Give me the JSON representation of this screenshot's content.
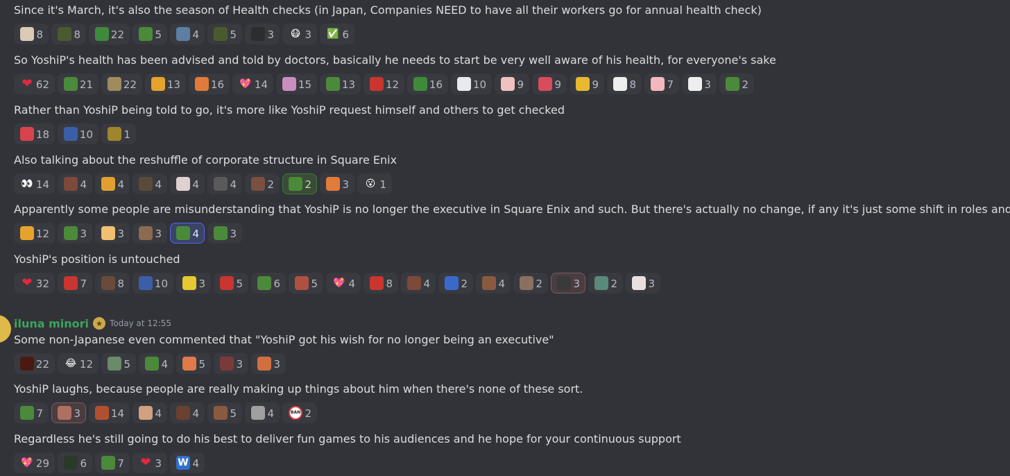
{
  "author": {
    "name": "iluna minori",
    "timestamp": "Today at 12:55",
    "badge_icon": "star-badge-icon",
    "name_color": "#3ba55c"
  },
  "messages": [
    "Since it's March, it's also the season of Health checks (in Japan, Companies NEED to have all their workers go for annual health check)",
    "So YoshiP's health has been advised and told by doctors, basically he needs to start be very well aware of his health, for everyone's sake",
    "Rather than YoshiP being told to go, it's more like YoshiP request himself and others to get checked",
    "Also talking about the reshuffle of corporate structure in Square Enix",
    "Apparently some people are misunderstanding that YoshiP is no longer the executive in Square Enix and such. But there's actually no change, if any it's just some shift in roles and so on",
    "YoshiP's position is untouched",
    "Some non-Japanese even commented that \"YoshiP got his wish for no longer being an executive\"",
    "YoshiP laughs, because people are really making up things about him  when there's none of these sort.",
    "Regardless he's still going to do his best to deliver fun games to his audiences and he hope for your continuous support"
  ],
  "reaction_rows": [
    [
      {
        "icon": "cat-emoji-icon",
        "count": "8",
        "bg": "#d9cbb5"
      },
      {
        "icon": "bamboo-emoji-icon",
        "count": "8",
        "bg": "#4b5a2e"
      },
      {
        "icon": "medic-cross-icon",
        "count": "22",
        "bg": "#3f8a3a"
      },
      {
        "icon": "frog-car-icon",
        "count": "5",
        "bg": "#4b8a3a"
      },
      {
        "icon": "robot-emoji-icon",
        "count": "4",
        "bg": "#5c7fa3"
      },
      {
        "icon": "bamboo-emoji-icon",
        "count": "5",
        "bg": "#4b5a2e"
      },
      {
        "icon": "blank-emoji-icon",
        "count": "3",
        "bg": "#2b2d31"
      },
      {
        "icon": "mask-face-icon",
        "count": "3",
        "glyph": "😷"
      },
      {
        "icon": "check-mark-icon",
        "count": "6",
        "glyph": "✅"
      }
    ],
    [
      {
        "icon": "heart-icon",
        "count": "62",
        "glyph": "❤"
      },
      {
        "icon": "frog-heart-icon",
        "count": "21",
        "bg": "#4b8a3a"
      },
      {
        "icon": "cat-emoji-icon",
        "count": "22",
        "bg": "#a08a60"
      },
      {
        "icon": "hug-heart-icon",
        "count": "13",
        "bg": "#e6a32c"
      },
      {
        "icon": "cat-hug-icon",
        "count": "16",
        "bg": "#e07b3a"
      },
      {
        "icon": "sparkle-heart-icon",
        "count": "14",
        "glyph": "💖"
      },
      {
        "icon": "anime-girl-icon",
        "count": "15",
        "bg": "#c98ec0"
      },
      {
        "icon": "frog-car-icon",
        "count": "13",
        "bg": "#4b8a3a"
      },
      {
        "icon": "crab-emoji-icon",
        "count": "12",
        "bg": "#c9352f"
      },
      {
        "icon": "medic-cross-icon",
        "count": "16",
        "bg": "#3f8a3a"
      },
      {
        "icon": "ghost-emoji-icon",
        "count": "10",
        "bg": "#e8e8ef"
      },
      {
        "icon": "chick-emoji-icon",
        "count": "9",
        "bg": "#f1c0c0"
      },
      {
        "icon": "heart-ring-icon",
        "count": "9",
        "bg": "#d94c5c"
      },
      {
        "icon": "duck-emoji-icon",
        "count": "9",
        "bg": "#e8b830"
      },
      {
        "icon": "chicken-emoji-icon",
        "count": "8",
        "bg": "#eeeeee"
      },
      {
        "icon": "pig-emoji-icon",
        "count": "7",
        "bg": "#f2b8c0"
      },
      {
        "icon": "bunny-emoji-icon",
        "count": "3",
        "bg": "#eeeeee"
      },
      {
        "icon": "frog-emoji-icon",
        "count": "2",
        "bg": "#4b8a3a"
      }
    ],
    [
      {
        "icon": "rocket-heart-icon",
        "count": "18",
        "bg": "#d9434b"
      },
      {
        "icon": "this-arrow-icon",
        "count": "10",
        "bg": "#3a5fa8"
      },
      {
        "icon": "bird-emoji-icon",
        "count": "1",
        "bg": "#a0852e"
      }
    ],
    [
      {
        "icon": "eyes-icon",
        "count": "14",
        "glyph": "👀"
      },
      {
        "icon": "anime-girl-icon",
        "count": "4",
        "bg": "#7d4a3a"
      },
      {
        "icon": "dancer-emoji-icon",
        "count": "4",
        "bg": "#e0a030"
      },
      {
        "icon": "knife-emoji-icon",
        "count": "4",
        "bg": "#5a4a3a"
      },
      {
        "icon": "anime-girl-icon",
        "count": "4",
        "bg": "#e0d0d0"
      },
      {
        "icon": "stonks-icon",
        "count": "4",
        "bg": "#5a5a5a"
      },
      {
        "icon": "man-face-icon",
        "count": "2",
        "bg": "#7a5040"
      },
      {
        "icon": "frog-emoji-icon",
        "count": "2",
        "bg": "#4b8a3a",
        "active": "green"
      },
      {
        "icon": "fire-emoji-icon",
        "count": "3",
        "bg": "#e07b3a"
      },
      {
        "icon": "surprised-face-icon",
        "count": "1",
        "glyph": "😮"
      }
    ],
    [
      {
        "icon": "hug-heart-icon",
        "count": "12",
        "bg": "#e6a32c"
      },
      {
        "icon": "frog-emoji-icon",
        "count": "3",
        "bg": "#4b8a3a"
      },
      {
        "icon": "chicken-emoji-icon",
        "count": "3",
        "bg": "#f0c070"
      },
      {
        "icon": "people-emoji-icon",
        "count": "3",
        "bg": "#8a6a50"
      },
      {
        "icon": "frog-car-icon",
        "count": "4",
        "bg": "#4b8a3a",
        "active": "blue"
      },
      {
        "icon": "frog-emoji-icon",
        "count": "3",
        "bg": "#4b8a3a"
      }
    ],
    [
      {
        "icon": "heart-icon",
        "count": "32",
        "glyph": "❤"
      },
      {
        "icon": "knife-emoji-icon",
        "count": "7",
        "bg": "#c9352f"
      },
      {
        "icon": "bird-emoji-icon",
        "count": "8",
        "bg": "#6a4a3a"
      },
      {
        "icon": "this-arrow-icon",
        "count": "10",
        "bg": "#3a5fa8"
      },
      {
        "icon": "minion-emoji-icon",
        "count": "3",
        "bg": "#e8c830"
      },
      {
        "icon": "devil-emoji-icon",
        "count": "5",
        "bg": "#c9352f"
      },
      {
        "icon": "frog-emoji-icon",
        "count": "6",
        "bg": "#4b8a3a"
      },
      {
        "icon": "man-face-icon",
        "count": "5",
        "bg": "#b05040"
      },
      {
        "icon": "sparkle-heart-icon",
        "count": "4",
        "glyph": "💖"
      },
      {
        "icon": "this-arrow-icon",
        "count": "8",
        "bg": "#c9352f"
      },
      {
        "icon": "anime-girl-icon",
        "count": "4",
        "bg": "#7d4a3a"
      },
      {
        "icon": "blue-character-icon",
        "count": "2",
        "bg": "#3a6ac9"
      },
      {
        "icon": "woman-emoji-icon",
        "count": "4",
        "bg": "#8a5a40"
      },
      {
        "icon": "man-face-icon",
        "count": "2",
        "bg": "#8a7060"
      },
      {
        "icon": "dark-character-icon",
        "count": "3",
        "bg": "#3a3a3a",
        "active": "red"
      },
      {
        "icon": "anime-girl-icon",
        "count": "2",
        "bg": "#5a8a7a"
      },
      {
        "icon": "anime-girl-icon",
        "count": "3",
        "bg": "#e8e0e0"
      }
    ],
    [
      {
        "icon": "circle-emoji-icon",
        "count": "22",
        "bg": "#4a1a12"
      },
      {
        "icon": "laughing-face-icon",
        "count": "12",
        "glyph": "😂"
      },
      {
        "icon": "monster-emoji-icon",
        "count": "5",
        "bg": "#6a8a6a"
      },
      {
        "icon": "frog-emoji-icon",
        "count": "4",
        "bg": "#4b8a3a"
      },
      {
        "icon": "man-face-icon",
        "count": "5",
        "bg": "#e07a4a"
      },
      {
        "icon": "lips-emoji-icon",
        "count": "3",
        "bg": "#7a3a3a"
      },
      {
        "icon": "man-face-icon",
        "count": "3",
        "bg": "#d07040"
      }
    ],
    [
      {
        "icon": "frog-car-icon",
        "count": "7",
        "bg": "#4b8a3a"
      },
      {
        "icon": "woman-emoji-icon",
        "count": "3",
        "bg": "#b07060",
        "active": "red"
      },
      {
        "icon": "eyes-closeup-icon",
        "count": "14",
        "bg": "#b05030"
      },
      {
        "icon": "man-face-icon",
        "count": "4",
        "bg": "#d0a080"
      },
      {
        "icon": "man-face-icon",
        "count": "4",
        "bg": "#6a4030"
      },
      {
        "icon": "woman-emoji-icon",
        "count": "5",
        "bg": "#8a5a40"
      },
      {
        "icon": "man-face-icon",
        "count": "4",
        "bg": "#a0a0a0"
      },
      {
        "icon": "ban-sign-icon",
        "count": "2",
        "glyph": "BAN"
      }
    ],
    [
      {
        "icon": "sparkle-heart-icon",
        "count": "29",
        "glyph": "💖"
      },
      {
        "icon": "bug-emoji-icon",
        "count": "6",
        "bg": "#2a3a2a"
      },
      {
        "icon": "frog-emoji-icon",
        "count": "7",
        "bg": "#4b8a3a"
      },
      {
        "icon": "heart-icon",
        "count": "3",
        "glyph": "❤"
      },
      {
        "icon": "letter-w-icon",
        "count": "4",
        "glyph": "W"
      }
    ]
  ]
}
